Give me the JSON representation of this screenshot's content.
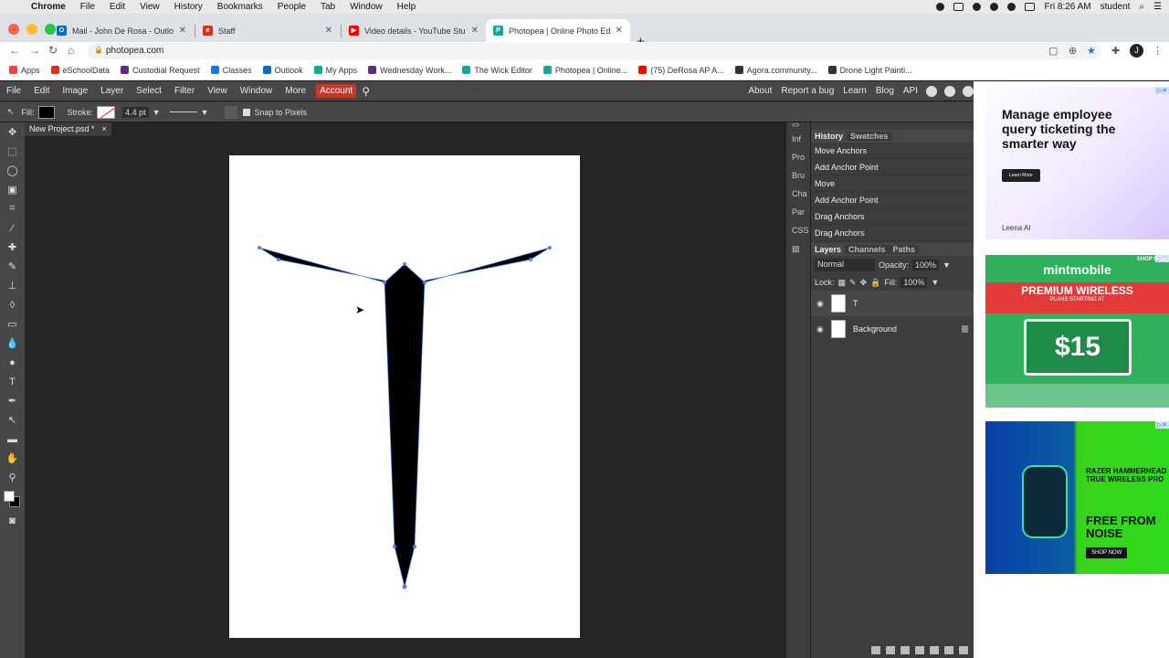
{
  "macos": {
    "app": "Chrome",
    "menus": [
      "File",
      "Edit",
      "View",
      "History",
      "Bookmarks",
      "People",
      "Tab",
      "Window",
      "Help"
    ],
    "clock": "Fri 8:26 AM",
    "user": "student"
  },
  "browser": {
    "tabs": [
      {
        "label": "Mail - John De Rosa - Outlook",
        "color": "#0f6cbd"
      },
      {
        "label": "Staff",
        "color": "#d93025"
      },
      {
        "label": "Video details - YouTube Studio",
        "color": "#ff0000"
      },
      {
        "label": "Photopea | Online Photo Editor",
        "color": "#18a497"
      }
    ],
    "url": "photopea.com",
    "profile_initial": "J",
    "bookmarks": [
      {
        "label": "Apps",
        "color": "#e8453c"
      },
      {
        "label": "eSchoolData",
        "color": "#d93025"
      },
      {
        "label": "Custodial Request",
        "color": "#5b2c83"
      },
      {
        "label": "Classes",
        "color": "#1a73e8"
      },
      {
        "label": "Outlook",
        "color": "#0f6cbd"
      },
      {
        "label": "My Apps",
        "color": "#18a497"
      },
      {
        "label": "Wednesday Work...",
        "color": "#5b2c83"
      },
      {
        "label": "The Wick Editor",
        "color": "#18a497"
      },
      {
        "label": "Photopea | Online...",
        "color": "#18a497"
      },
      {
        "label": "(75) DeRosa AP A...",
        "color": "#ff0000"
      },
      {
        "label": "Agora.community...",
        "color": "#333333"
      },
      {
        "label": "Drone Light Painti...",
        "color": "#333333"
      }
    ]
  },
  "photopea": {
    "menu": [
      "File",
      "Edit",
      "Image",
      "Layer",
      "Select",
      "Filter",
      "View",
      "Window",
      "More"
    ],
    "account": "Account",
    "right_links": [
      "About",
      "Report a bug",
      "Learn",
      "Blog",
      "API"
    ],
    "options": {
      "fill_label": "Fill:",
      "stroke_label": "Stroke:",
      "stroke_width": "4.4 pt",
      "snap": "Snap to Pixels"
    },
    "doc_tab": "New Project.psd *",
    "doc_close": "×",
    "collapsed_panels": [
      "Inf",
      "Pro",
      "Bru",
      "Cha",
      "Par",
      "CSS"
    ],
    "history_tabs": [
      "History",
      "Swatches"
    ],
    "history": [
      "Move Anchors",
      "Add Anchor Point",
      "Move",
      "Add Anchor Point",
      "Drag Anchors",
      "Drag Anchors"
    ],
    "layers_tabs": [
      "Layers",
      "Channels",
      "Paths"
    ],
    "blend_mode": "Normal",
    "opacity_label": "Opacity:",
    "opacity": "100%",
    "lock_label": "Lock:",
    "fill_label": "Fill:",
    "fill": "100%",
    "layers": [
      {
        "name": "T"
      },
      {
        "name": "Background"
      }
    ]
  },
  "ads": {
    "ad1": {
      "headline": "Manage employee query ticketing the smarter way",
      "cta": "Learn More",
      "brand": "Leena AI"
    },
    "ad2": {
      "brand": "mintmobile",
      "band_title": "PREMIUM WIRELESS",
      "band_sub": "PLANS STARTING AT",
      "price": "$15",
      "side": "SHOP NOW"
    },
    "ad3": {
      "small": "RAZER HAMMERHEAD TRUE WIRELESS PRO",
      "big": "FREE FROM NOISE",
      "cta": "SHOP NOW"
    }
  }
}
